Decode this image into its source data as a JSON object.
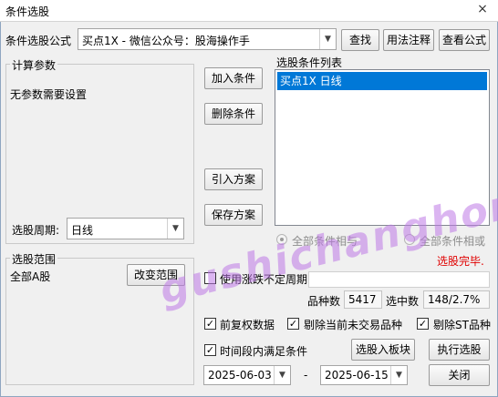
{
  "window": {
    "title": "条件选股",
    "close_glyph": "×"
  },
  "formula": {
    "label": "条件选股公式",
    "selected": "买点1X  -  微信公众号：股海操作手",
    "find_button": "查找",
    "usage_button": "用法注释",
    "view_button": "查看公式"
  },
  "params": {
    "group_title": "计算参数",
    "message": "无参数需要设置",
    "period_label": "选股周期:",
    "period_value": "日线"
  },
  "actions": {
    "add": "加入条件",
    "remove": "删除条件",
    "import": "引入方案",
    "save": "保存方案"
  },
  "condition_list": {
    "title": "选股条件列表",
    "items": [
      "买点1X  日线"
    ]
  },
  "logic": {
    "all_and": "全部条件相与",
    "all_or": "全部条件相或",
    "selected": "all_and"
  },
  "status_text": "选股完毕.",
  "range": {
    "group_title": "选股范围",
    "value": "全部A股",
    "change_button": "改变范围"
  },
  "options": {
    "variable_period_label": "使用涨跌不定周期",
    "variable_period_checked": false,
    "variety_count_label": "品种数",
    "variety_count": "5417",
    "hit_count_label": "选中数",
    "hit_count": "148/2.7%",
    "forward_adjust_label": "前复权数据",
    "forward_adjust_checked": true,
    "exclude_untraded_label": "剔除当前未交易品种",
    "exclude_untraded_checked": true,
    "exclude_st_label": "剔除ST品种",
    "exclude_st_checked": true,
    "time_range_label": "时间段内满足条件",
    "time_range_checked": true,
    "check_glyph": "✓"
  },
  "dates": {
    "start": "2025-06-03",
    "separator": "-",
    "end": "2025-06-15"
  },
  "buttons": {
    "to_block": "选股入板块",
    "execute": "执行选股",
    "close": "关闭"
  },
  "combo_arrow": "▼",
  "watermark": "gushichanghong.com"
}
